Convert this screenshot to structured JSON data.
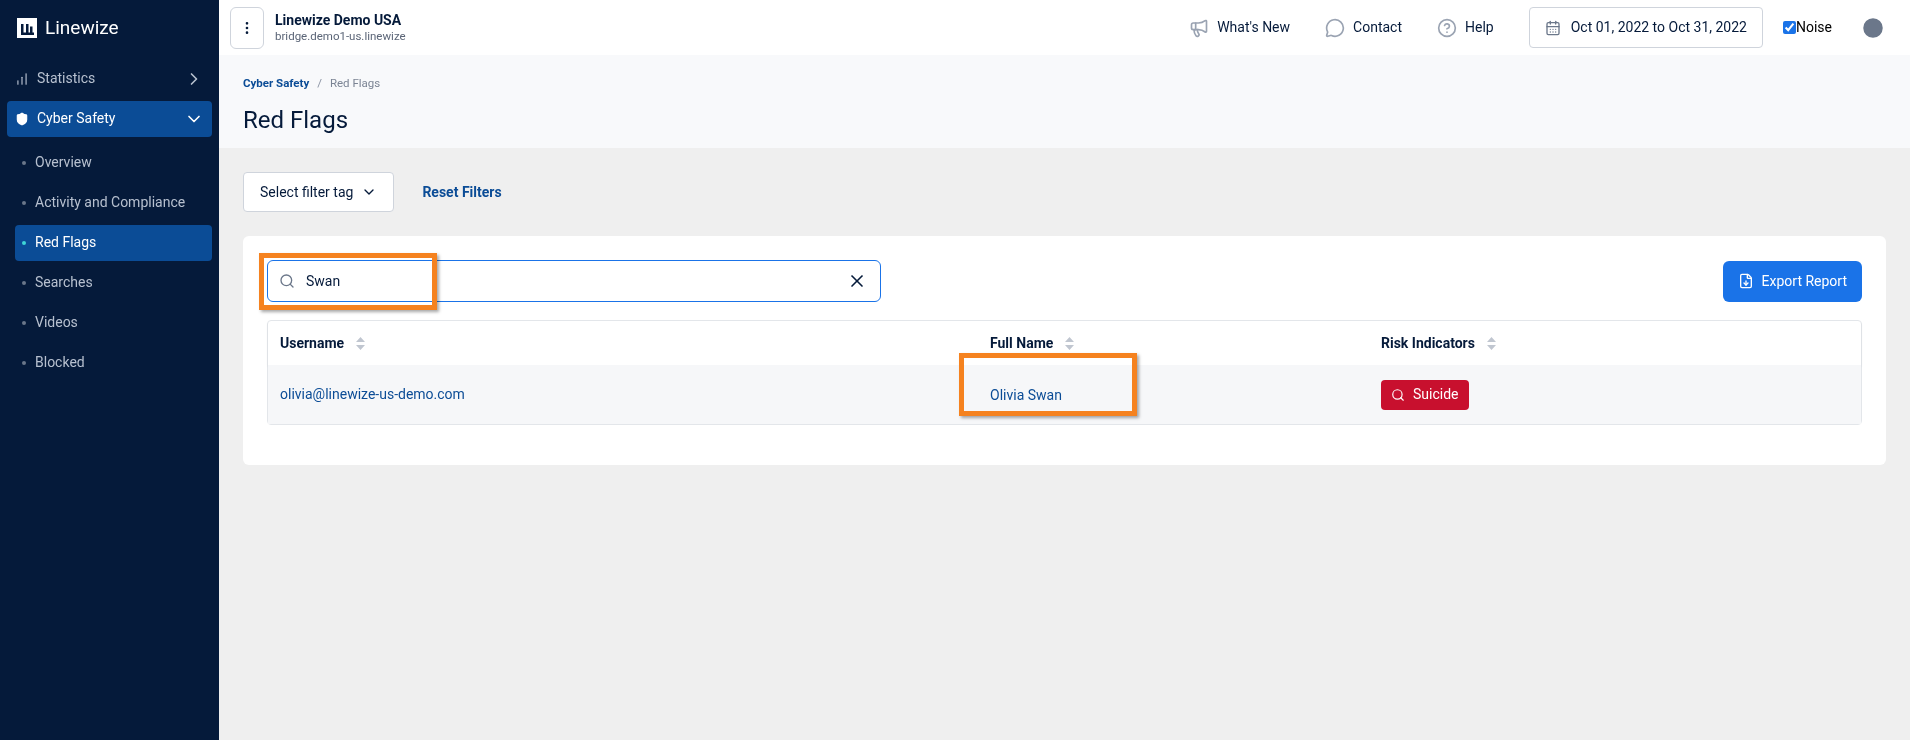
{
  "brand": {
    "name": "Linewize"
  },
  "sidebar": {
    "items": [
      {
        "label": "Statistics",
        "expanded": false,
        "selected": false
      },
      {
        "label": "Cyber Safety",
        "expanded": true,
        "selected": true,
        "children": [
          {
            "label": "Overview",
            "selected": false
          },
          {
            "label": "Activity and Compliance",
            "selected": false
          },
          {
            "label": "Red Flags",
            "selected": true
          },
          {
            "label": "Searches",
            "selected": false
          },
          {
            "label": "Videos",
            "selected": false
          },
          {
            "label": "Blocked",
            "selected": false
          }
        ]
      }
    ]
  },
  "header": {
    "org_name": "Linewize Demo USA",
    "org_host": "bridge.demo1-us.linewize",
    "links": [
      {
        "label": "What's New"
      },
      {
        "label": "Contact"
      },
      {
        "label": "Help"
      }
    ],
    "date_range": "Oct 01, 2022 to Oct 31, 2022",
    "noise": {
      "label": "Noise",
      "checked": true
    }
  },
  "breadcrumb": {
    "separator": "/",
    "items": [
      "Cyber Safety",
      "Red Flags"
    ]
  },
  "page_title": "Red Flags",
  "filters": {
    "select_label": "Select filter tag",
    "reset_label": "Reset Filters"
  },
  "search": {
    "value": "Swan",
    "highlighted": true
  },
  "export_button": "Export Report",
  "table": {
    "columns": [
      "Username",
      "Full Name",
      "Risk Indicators"
    ],
    "rows": [
      {
        "username": "olivia@linewize-us-demo.com",
        "full_name": "Olivia Swan",
        "full_name_highlighted": true,
        "risk_indicators": [
          {
            "label": "Suicide",
            "color": "#c8102e"
          }
        ]
      }
    ]
  }
}
